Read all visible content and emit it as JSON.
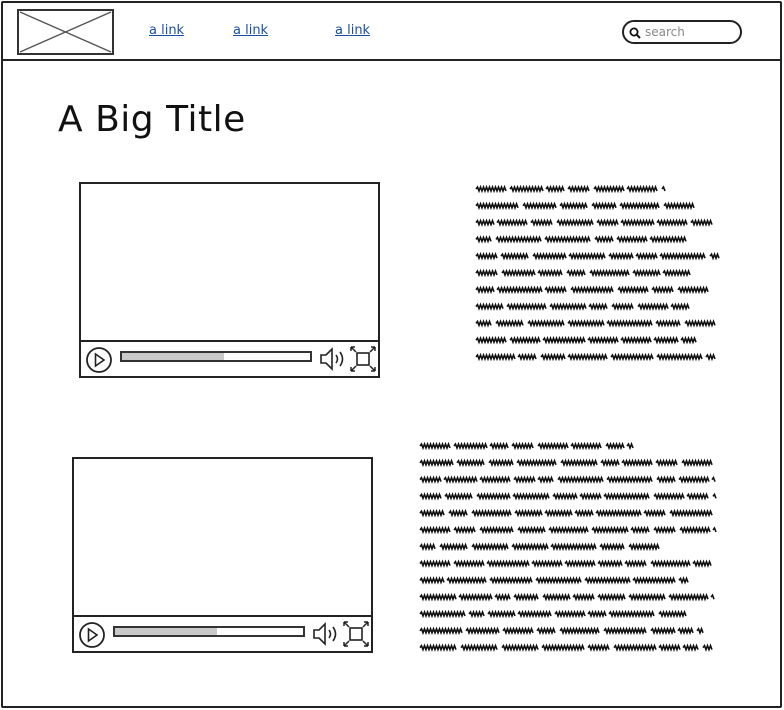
{
  "header": {
    "nav_links": [
      "a link",
      "a link",
      "a link"
    ],
    "search": {
      "placeholder": "search"
    }
  },
  "page": {
    "title": "A Big Title"
  },
  "videos": [
    {
      "progress": 0.54
    },
    {
      "progress": 0.54
    }
  ],
  "icons": [
    "image-placeholder-icon",
    "search-icon",
    "play-icon",
    "volume-icon",
    "fullscreen-icon"
  ],
  "colors": {
    "border": "#222222",
    "link": "#1a4ea3",
    "progress_fill": "#c9c9c9"
  }
}
